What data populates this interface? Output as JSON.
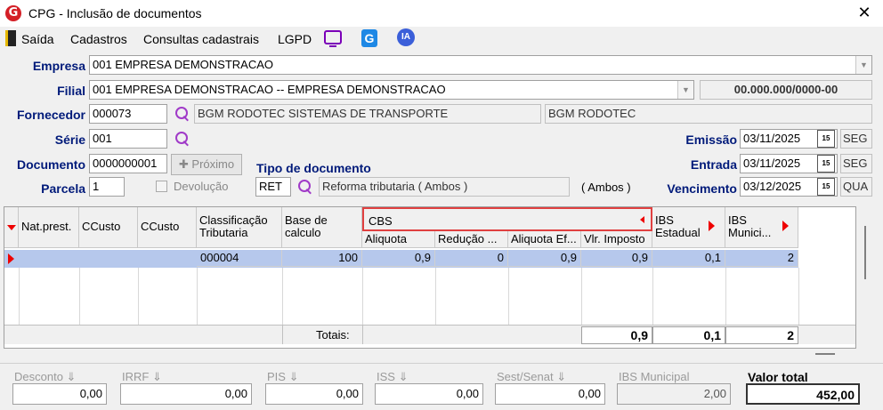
{
  "window": {
    "app_icon": "G",
    "title": "CPG - Inclusão de documentos",
    "close": "✕"
  },
  "menu": {
    "items": [
      "Saída",
      "Cadastros",
      "Consultas cadastrais",
      "LGPD"
    ],
    "icons": [
      "exit-icon",
      "screen-icon",
      "g-app-icon",
      "ia-icon"
    ],
    "ia_label": "IA",
    "g_label": "G"
  },
  "form": {
    "empresa_label": "Empresa",
    "empresa_value": "001 EMPRESA DEMONSTRACAO",
    "filial_label": "Filial",
    "filial_value": "001 EMPRESA DEMONSTRACAO -- EMPRESA DEMONSTRACAO",
    "cnpj_value": "00.000.000/0000-00",
    "fornecedor_label": "Fornecedor",
    "fornecedor_code": "000073",
    "fornecedor_name": "BGM RODOTEC SISTEMAS DE TRANSPORTE",
    "fornecedor_short": "BGM RODOTEC",
    "serie_label": "Série",
    "serie_value": "001",
    "documento_label": "Documento",
    "documento_value": "0000000001",
    "proximo_label": "Próximo",
    "parcela_label": "Parcela",
    "parcela_value": "1",
    "devolucao_label": "Devolução",
    "tipo_doc_label": "Tipo de documento",
    "tipo_doc_code": "RET",
    "tipo_doc_desc": "Reforma tributaria ( Ambos )",
    "tipo_doc_scope": "( Ambos )",
    "emissao_label": "Emissão",
    "emissao_date": "03/11/2025",
    "emissao_day": "SEG",
    "entrada_label": "Entrada",
    "entrada_date": "03/11/2025",
    "entrada_day": "SEG",
    "vencimento_label": "Vencimento",
    "vencimento_date": "03/12/2025",
    "vencimento_day": "QUA",
    "calendar_label": "15"
  },
  "grid": {
    "headers": {
      "nat_prest": "Nat.prest.",
      "ccusto1": "CCusto",
      "ccusto2": "CCusto",
      "classificacao": [
        "Classificação",
        "Tributaria"
      ],
      "base_calculo": [
        "Base de",
        "calculo"
      ],
      "cbs": "CBS",
      "cbs_sub": [
        "Aliquota",
        "Redução ...",
        "Aliquota Ef...",
        "Vlr. Imposto"
      ],
      "ibs_estadual": [
        "IBS",
        "Estadual"
      ],
      "ibs_municipal": [
        "IBS",
        "Munici..."
      ]
    },
    "rows": [
      {
        "classificacao": "000004",
        "base": "100",
        "aliquota": "0,9",
        "reducao": "0",
        "aliquota_ef": "0,9",
        "vlr_imposto": "0,9",
        "ibs_estadual": "0,1",
        "ibs_municipal": "2"
      }
    ],
    "totals": {
      "label": "Totais:",
      "vlr_imposto": "0,9",
      "ibs_estadual": "0,1",
      "ibs_municipal": "2"
    }
  },
  "footer": {
    "desconto_label": "Desconto",
    "desconto": "0,00",
    "irrf_label": "IRRF",
    "irrf": "0,00",
    "pis_label": "PIS",
    "pis": "0,00",
    "iss_label": "ISS",
    "iss": "0,00",
    "sest_label": "Sest/Senat",
    "sest": "0,00",
    "ibs_mun_label": "IBS Municipal",
    "ibs_mun": "2,00",
    "valor_total_label": "Valor total",
    "valor_total": "452,00",
    "sort_glyph": "⇓"
  },
  "colors": {
    "selected_row": "#b6c8ec",
    "accent_red": "#e00000",
    "label_blue": "#001a7a",
    "search_purple": "#a03ac8"
  }
}
